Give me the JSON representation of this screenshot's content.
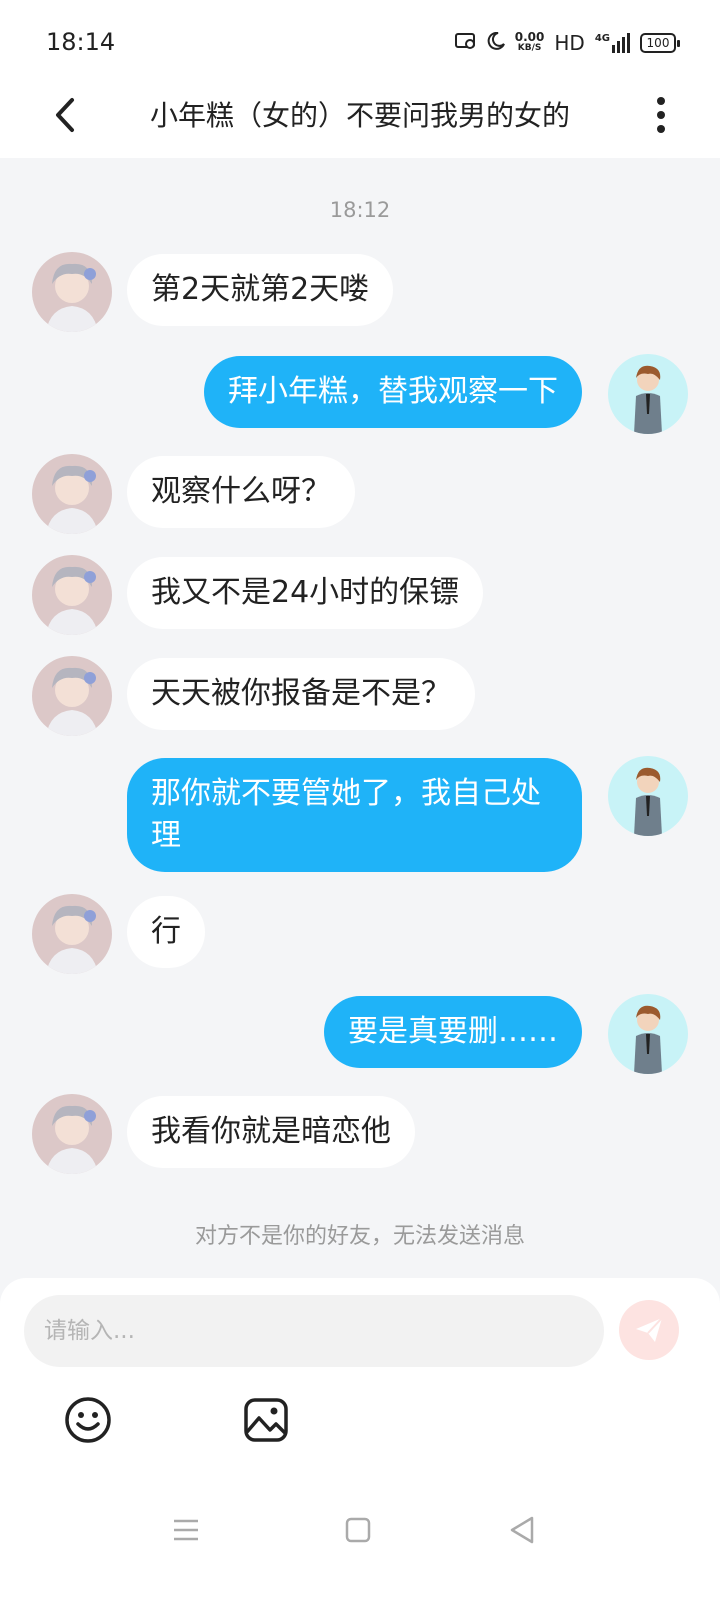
{
  "status_bar": {
    "time": "18:14",
    "net_speed_value": "0.00",
    "net_speed_unit": "KB/S",
    "hd": "HD",
    "signal": "4G",
    "battery": "100"
  },
  "header": {
    "title": "小年糕（女的）不要问我男的女的",
    "back_icon": "chevron-left-icon",
    "more_icon": "more-vertical-icon"
  },
  "chat": {
    "timestamp": "18:12",
    "messages": [
      {
        "side": "left",
        "text": "第2天就第2天喽"
      },
      {
        "side": "right",
        "text": "拜小年糕，替我观察一下"
      },
      {
        "side": "left",
        "text": "观察什么呀？"
      },
      {
        "side": "left",
        "text": "我又不是24小时的保镖"
      },
      {
        "side": "left",
        "text": "天天被你报备是不是？"
      },
      {
        "side": "right",
        "text": "那你就不要管她了，我自己处理"
      },
      {
        "side": "left",
        "text": "行"
      },
      {
        "side": "right",
        "text": "要是真要删……"
      },
      {
        "side": "left",
        "text": "我看你就是暗恋他"
      }
    ],
    "notice": "对方不是你的好友，无法发送消息"
  },
  "input": {
    "placeholder": "请输入...",
    "value": ""
  },
  "icons": {
    "send": "send-icon",
    "emoji": "emoji-icon",
    "image": "image-icon"
  },
  "colors": {
    "accent_bubble": "#1fb3f8",
    "background": "#f4f5f7",
    "send_button_disabled": "#fde3e1"
  }
}
